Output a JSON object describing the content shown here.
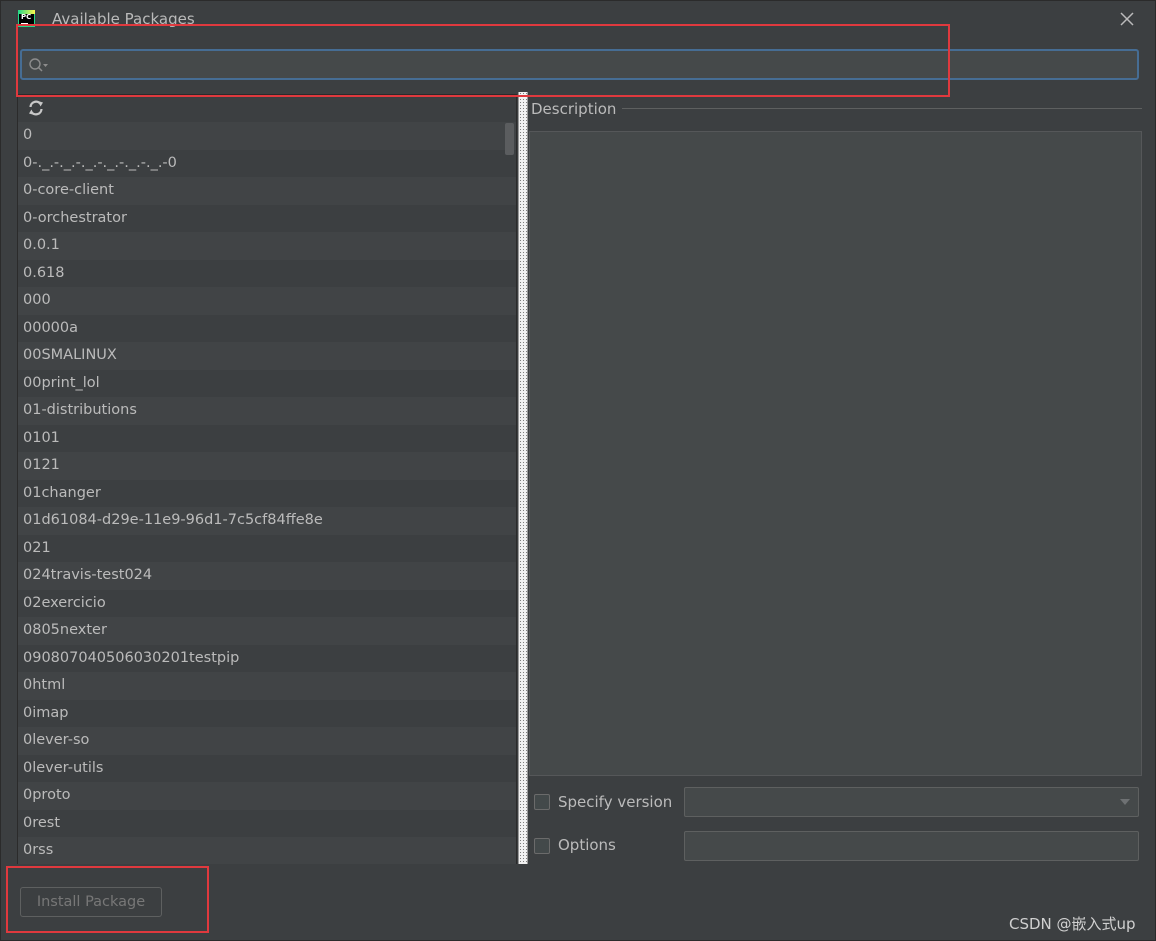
{
  "window": {
    "title": "Available Packages",
    "icon": "pycharm-logo-icon",
    "icon_text": "PC",
    "close_icon": "close-icon"
  },
  "search": {
    "value": "",
    "placeholder": "",
    "icon": "search-icon"
  },
  "toolbar": {
    "refresh_icon": "refresh-icon"
  },
  "packages": [
    "0",
    "0-._.-._.-._.-._.-._.-._.-0",
    "0-core-client",
    "0-orchestrator",
    "0.0.1",
    "0.618",
    "000",
    "00000a",
    "00SMALINUX",
    "00print_lol",
    "01-distributions",
    "0101",
    "0121",
    "01changer",
    "01d61084-d29e-11e9-96d1-7c5cf84ffe8e",
    "021",
    "024travis-test024",
    "02exercicio",
    "0805nexter",
    "090807040506030201testpip",
    "0html",
    "0imap",
    "0lever-so",
    "0lever-utils",
    "0proto",
    "0rest",
    "0rss"
  ],
  "description": {
    "label": "Description",
    "text": ""
  },
  "specify_version": {
    "label": "Specify version",
    "checked": false,
    "value": ""
  },
  "options": {
    "label": "Options",
    "checked": false,
    "value": ""
  },
  "install_button": {
    "label": "Install Package",
    "enabled": false
  },
  "watermark": "CSDN @嵌入式up",
  "colors": {
    "background": "#3c3f41",
    "input_bg": "#45494a",
    "focus_border": "#466d94",
    "annotation_red": "#e0393e",
    "text": "#bbbbbb"
  }
}
